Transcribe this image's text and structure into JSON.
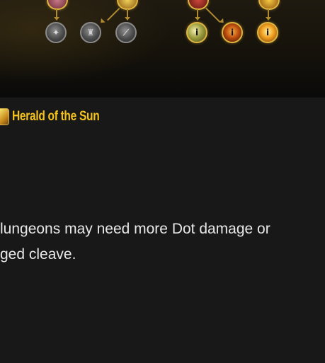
{
  "talent_tree": {
    "nodes": [
      {
        "name": "node-top-a-icon",
        "style": "gold-half"
      },
      {
        "name": "node-top-b-icon",
        "style": "gold-half"
      },
      {
        "name": "node-top-c-icon",
        "style": "gold-half"
      },
      {
        "name": "node-top-d-icon",
        "style": "gold-half"
      },
      {
        "name": "node-grey-1-icon",
        "style": "grey"
      },
      {
        "name": "node-grey-2-icon",
        "style": "grey"
      },
      {
        "name": "node-grey-3-icon",
        "style": "grey"
      },
      {
        "name": "node-gold-1-icon",
        "style": "gold"
      },
      {
        "name": "node-gold-2-icon",
        "style": "gold"
      },
      {
        "name": "node-gold-3-icon",
        "style": "gold"
      }
    ],
    "node_badge": "i",
    "colors": {
      "gold": "#e0b640",
      "grey": "#8a8a8a",
      "connector": "#b08a30"
    }
  },
  "section": {
    "title": "Herald of the Sun",
    "title_color": "#f4c21c",
    "icon": "herald-sun-icon"
  },
  "description": {
    "lines": [
      "lungeons may need more Dot damage or",
      "ged cleave."
    ]
  }
}
